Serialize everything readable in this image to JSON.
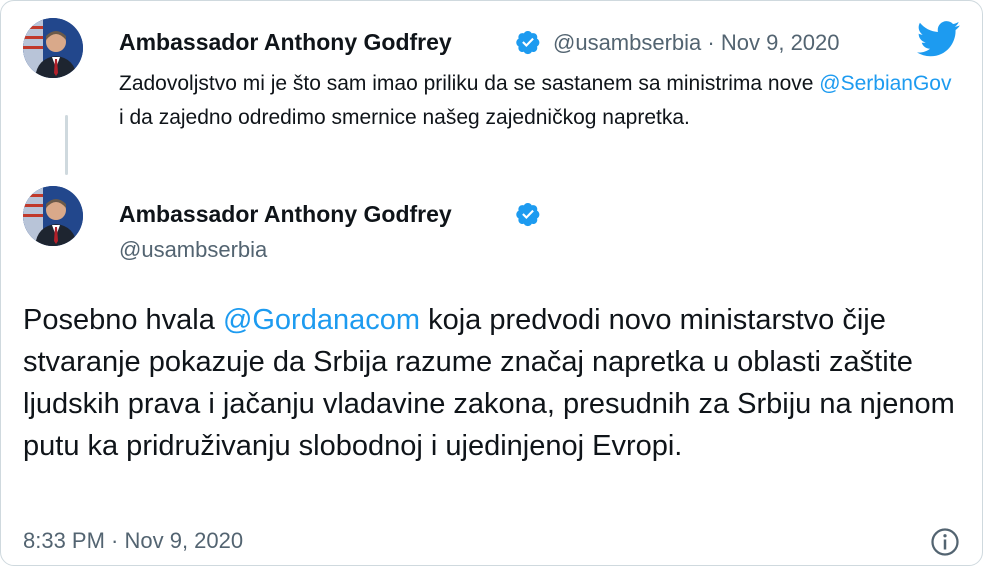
{
  "colors": {
    "link": "#1d9bf0",
    "verified": "#1d9bf0",
    "secondary": "#536471",
    "twitter": "#1d9bf0"
  },
  "icons": {
    "brand": "twitter-bird-icon",
    "verified": "verified-badge-icon",
    "info": "info-icon"
  },
  "quoted_tweet": {
    "author_name": "Ambassador Anthony Godfrey",
    "handle": "@usambserbia",
    "separator": "·",
    "date": "Nov 9, 2020",
    "text_parts": [
      {
        "text": "Zadovoljstvo mi je što sam imao priliku da se sastanem sa ministrima nove ",
        "type": "text"
      },
      {
        "text": "@SerbianGov",
        "type": "mention"
      },
      {
        "text": " i da zajedno odredimo smernice našeg zajedničkog napretka.",
        "type": "text"
      }
    ]
  },
  "main_tweet": {
    "author_name": "Ambassador Anthony Godfrey",
    "handle": "@usambserbia",
    "text_parts": [
      {
        "text": "Posebno hvala ",
        "type": "text"
      },
      {
        "text": "@Gordanacom",
        "type": "mention"
      },
      {
        "text": " koja predvodi novo ministarstvo čije stvaranje pokazuje da Srbija razume značaj napretka u oblasti zaštite ljudskih prava i jačanju vladavine zakona, presudnih za Srbiju na njenom putu ka pridruživanju slobodnoj i ujedinjenoj Evropi.",
        "type": "text"
      }
    ],
    "timestamp": "8:33 PM · Nov 9, 2020"
  }
}
